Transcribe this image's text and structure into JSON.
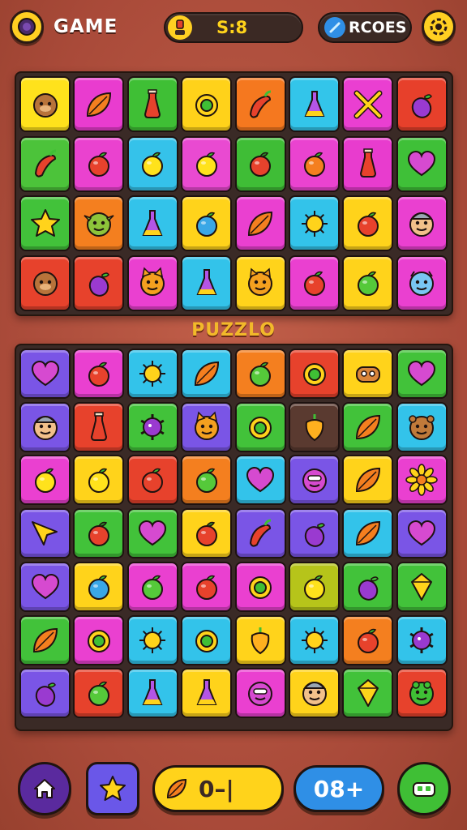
{
  "header": {
    "title": "GAME",
    "score_text": "S:8",
    "right_pill_text": "RCOES",
    "colors": {
      "accent": "#ffcf22",
      "pill_bg": "#3b2924"
    }
  },
  "board_label": "PUZZLO",
  "board_top": {
    "rows": [
      [
        {
          "color": "#ffe21c",
          "icon": "monkey-face-icon"
        },
        {
          "color": "#e93ccf",
          "icon": "leaf-icon"
        },
        {
          "color": "#3fbf35",
          "icon": "bottle-icon"
        },
        {
          "color": "#ffd21a",
          "icon": "ring-icon"
        },
        {
          "color": "#f5781f",
          "icon": "chili-pepper-icon"
        },
        {
          "color": "#33c5ea",
          "icon": "potion-icon"
        },
        {
          "color": "#ea3fd1",
          "icon": "crossed-swords-icon"
        },
        {
          "color": "#e7402b",
          "icon": "eggplant-icon"
        }
      ],
      [
        {
          "color": "#4cc33a",
          "icon": "chili-pepper-icon"
        },
        {
          "color": "#ea42cf",
          "icon": "tomato-icon"
        },
        {
          "color": "#35c2ea",
          "icon": "lemon-icon"
        },
        {
          "color": "#e94ad1",
          "icon": "lemon-icon"
        },
        {
          "color": "#3fbd36",
          "icon": "berry-icon"
        },
        {
          "color": "#ea43d0",
          "icon": "orange-fruit-icon"
        },
        {
          "color": "#e83cce",
          "icon": "bottle-icon"
        },
        {
          "color": "#3fc038",
          "icon": "heart-icon"
        }
      ],
      [
        {
          "color": "#42c23a",
          "icon": "star-icon"
        },
        {
          "color": "#f47f1f",
          "icon": "goblin-face-icon"
        },
        {
          "color": "#33c3ea",
          "icon": "potion-icon"
        },
        {
          "color": "#ffd31b",
          "icon": "blueberry-icon"
        },
        {
          "color": "#ea40d0",
          "icon": "leaf-icon"
        },
        {
          "color": "#33c3ea",
          "icon": "sun-icon"
        },
        {
          "color": "#ffd31b",
          "icon": "tomato-icon"
        },
        {
          "color": "#ea40d0",
          "icon": "elf-face-icon"
        }
      ],
      [
        {
          "color": "#e7422c",
          "icon": "monkey-face-icon"
        },
        {
          "color": "#e7422c",
          "icon": "eggplant-icon"
        },
        {
          "color": "#ea40d0",
          "icon": "fox-face-icon"
        },
        {
          "color": "#33c3ea",
          "icon": "potion-icon"
        },
        {
          "color": "#ffd31b",
          "icon": "cat-face-icon"
        },
        {
          "color": "#ea40d0",
          "icon": "apple-icon"
        },
        {
          "color": "#ffd31b",
          "icon": "green-apple-icon"
        },
        {
          "color": "#ea40d0",
          "icon": "blue-monster-icon"
        }
      ]
    ]
  },
  "board_bottom": {
    "rows": [
      [
        {
          "color": "#7a55e6",
          "icon": "heart-icon"
        },
        {
          "color": "#ea40d0",
          "icon": "tomato-icon"
        },
        {
          "color": "#33c3ea",
          "icon": "sun-icon"
        },
        {
          "color": "#33c3ea",
          "icon": "leaf-icon"
        },
        {
          "color": "#f47f1f",
          "icon": "green-apple-icon"
        },
        {
          "color": "#e7422c",
          "icon": "ring-icon"
        },
        {
          "color": "#ffd31b",
          "icon": "toy-icon"
        },
        {
          "color": "#42c23a",
          "icon": "heart-icon"
        }
      ],
      [
        {
          "color": "#7a55e6",
          "icon": "elf-face-icon"
        },
        {
          "color": "#e7422c",
          "icon": "bottle-icon"
        },
        {
          "color": "#42c23a",
          "icon": "virus-icon"
        },
        {
          "color": "#7a55e6",
          "icon": "fox-face-icon"
        },
        {
          "color": "#42c23a",
          "icon": "ring-icon"
        },
        {
          "color": "#5a3a30",
          "icon": "bell-pepper-icon"
        },
        {
          "color": "#42c23a",
          "icon": "leaf-icon"
        },
        {
          "color": "#33c3ea",
          "icon": "bear-face-icon"
        }
      ],
      [
        {
          "color": "#ea40d0",
          "icon": "lemon-icon"
        },
        {
          "color": "#ffd31b",
          "icon": "lemon-icon"
        },
        {
          "color": "#e7422c",
          "icon": "tomato-icon"
        },
        {
          "color": "#f47f1f",
          "icon": "green-apple-icon"
        },
        {
          "color": "#33c3ea",
          "icon": "heart-icon"
        },
        {
          "color": "#7a55e6",
          "icon": "monster-face-icon"
        },
        {
          "color": "#ffd31b",
          "icon": "leaf-icon"
        },
        {
          "color": "#ea40d0",
          "icon": "sunflower-icon"
        }
      ],
      [
        {
          "color": "#7a55e6",
          "icon": "arrow-icon"
        },
        {
          "color": "#42c23a",
          "icon": "berry-icon"
        },
        {
          "color": "#42c23a",
          "icon": "heart-icon"
        },
        {
          "color": "#ffd31b",
          "icon": "berry-icon"
        },
        {
          "color": "#7a55e6",
          "icon": "chili-pepper-icon"
        },
        {
          "color": "#7a55e6",
          "icon": "eggplant-icon"
        },
        {
          "color": "#33c3ea",
          "icon": "leaf-icon"
        },
        {
          "color": "#7a55e6",
          "icon": "heart-icon"
        }
      ],
      [
        {
          "color": "#7a55e6",
          "icon": "heart-icon"
        },
        {
          "color": "#ffd31b",
          "icon": "blueberry-icon"
        },
        {
          "color": "#ea40d0",
          "icon": "green-apple-icon"
        },
        {
          "color": "#ea40d0",
          "icon": "tomato-icon"
        },
        {
          "color": "#ea40d0",
          "icon": "ring-icon"
        },
        {
          "color": "#b6c41a",
          "icon": "lemon-icon"
        },
        {
          "color": "#42c23a",
          "icon": "eggplant-icon"
        },
        {
          "color": "#42c23a",
          "icon": "gem-icon"
        }
      ],
      [
        {
          "color": "#42c23a",
          "icon": "leaf-icon"
        },
        {
          "color": "#ea40d0",
          "icon": "ring-icon"
        },
        {
          "color": "#33c3ea",
          "icon": "sun-icon"
        },
        {
          "color": "#33c3ea",
          "icon": "ring-icon"
        },
        {
          "color": "#ffd31b",
          "icon": "bell-pepper-icon"
        },
        {
          "color": "#33c3ea",
          "icon": "sun-icon"
        },
        {
          "color": "#f47f1f",
          "icon": "apple-icon"
        },
        {
          "color": "#33c3ea",
          "icon": "virus-icon"
        }
      ],
      [
        {
          "color": "#7a55e6",
          "icon": "eggplant-icon"
        },
        {
          "color": "#e7422c",
          "icon": "green-apple-icon"
        },
        {
          "color": "#33c3ea",
          "icon": "potion-icon"
        },
        {
          "color": "#ffd31b",
          "icon": "potion-icon"
        },
        {
          "color": "#ea40d0",
          "icon": "monster-face-icon"
        },
        {
          "color": "#ffd31b",
          "icon": "elf-face-icon"
        },
        {
          "color": "#42c23a",
          "icon": "gem-icon"
        },
        {
          "color": "#e7422c",
          "icon": "frog-face-icon"
        }
      ]
    ]
  },
  "footer": {
    "moves_text": "0–|",
    "counter_text": "08+",
    "colors": {
      "home": "#5a2a9e",
      "star": "#6a57e8",
      "moves": "#ffd31b",
      "counter": "#2f8fe6",
      "menu": "#3fbf35"
    }
  }
}
